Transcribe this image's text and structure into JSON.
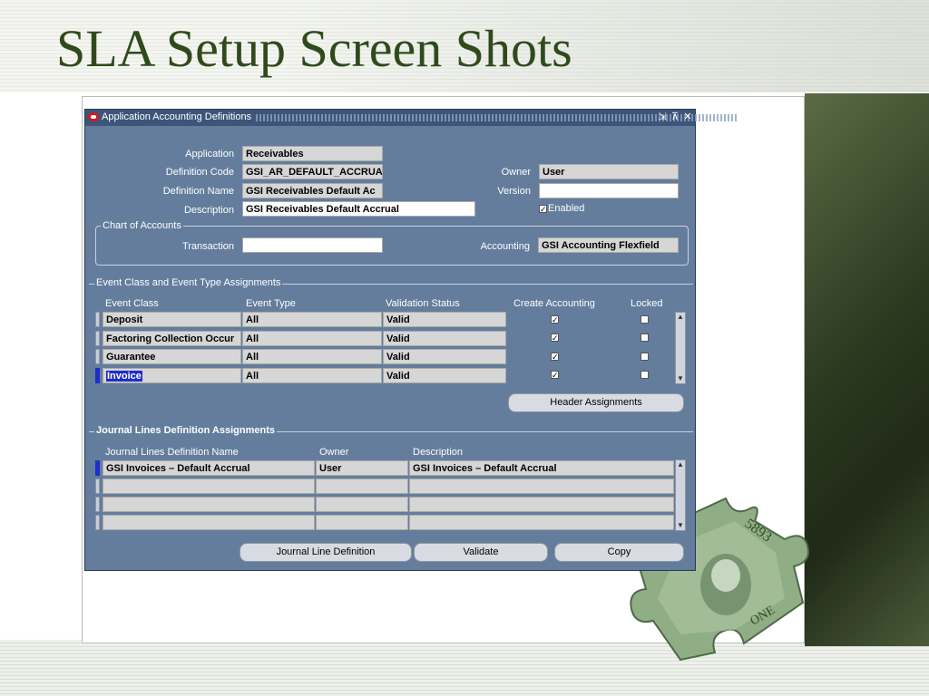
{
  "slide": {
    "title": "SLA Setup Screen Shots"
  },
  "window": {
    "title": "Application Accounting Definitions",
    "buttons": {
      "minimize": "⇲",
      "maximize": "⊼",
      "close": "✕"
    }
  },
  "header": {
    "application_label": "Application",
    "application_value": "Receivables",
    "definition_code_label": "Definition Code",
    "definition_code_value": "GSI_AR_DEFAULT_ACCRUA",
    "definition_name_label": "Definition Name",
    "definition_name_value": "GSI Receivables Default Ac",
    "description_label": "Description",
    "description_value": "GSI Receivables Default Accrual",
    "owner_label": "Owner",
    "owner_value": "User",
    "version_label": "Version",
    "version_value": "",
    "enabled_label": "Enabled",
    "enabled_checked": true
  },
  "chart_of_accounts": {
    "title": "Chart of Accounts",
    "transaction_label": "Transaction",
    "transaction_value": "",
    "accounting_label": "Accounting",
    "accounting_value": "GSI Accounting Flexfield"
  },
  "event_assignments": {
    "title": "Event Class and Event Type Assignments",
    "columns": [
      "Event Class",
      "Event Type",
      "Validation Status",
      "Create Accounting",
      "Locked"
    ],
    "rows": [
      {
        "event_class": "Deposit",
        "event_type": "All",
        "status": "Valid",
        "create_accounting": true,
        "locked": false
      },
      {
        "event_class": "Factoring Collection Occur",
        "event_type": "All",
        "status": "Valid",
        "create_accounting": true,
        "locked": false
      },
      {
        "event_class": "Guarantee",
        "event_type": "All",
        "status": "Valid",
        "create_accounting": true,
        "locked": false
      },
      {
        "event_class": "Invoice",
        "event_type": "All",
        "status": "Valid",
        "create_accounting": true,
        "locked": false
      }
    ],
    "header_assignments_button": "Header Assignments"
  },
  "journal_lines": {
    "title": "Journal Lines Definition Assignments",
    "columns": [
      "Journal Lines Definition Name",
      "Owner",
      "Description"
    ],
    "rows": [
      {
        "name": "GSI Invoices – Default Accrual",
        "owner": "User",
        "description": "GSI Invoices – Default Accrual"
      },
      {
        "name": "",
        "owner": "",
        "description": ""
      },
      {
        "name": "",
        "owner": "",
        "description": ""
      },
      {
        "name": "",
        "owner": "",
        "description": ""
      }
    ]
  },
  "footer_buttons": {
    "journal_line_definition": "Journal Line Definition",
    "validate": "Validate",
    "copy": "Copy"
  },
  "colors": {
    "window_bg": "#647d9d",
    "titlebar": "#3d5579",
    "title_text": "#2f4a1b",
    "selection": "#1d2ec9"
  }
}
